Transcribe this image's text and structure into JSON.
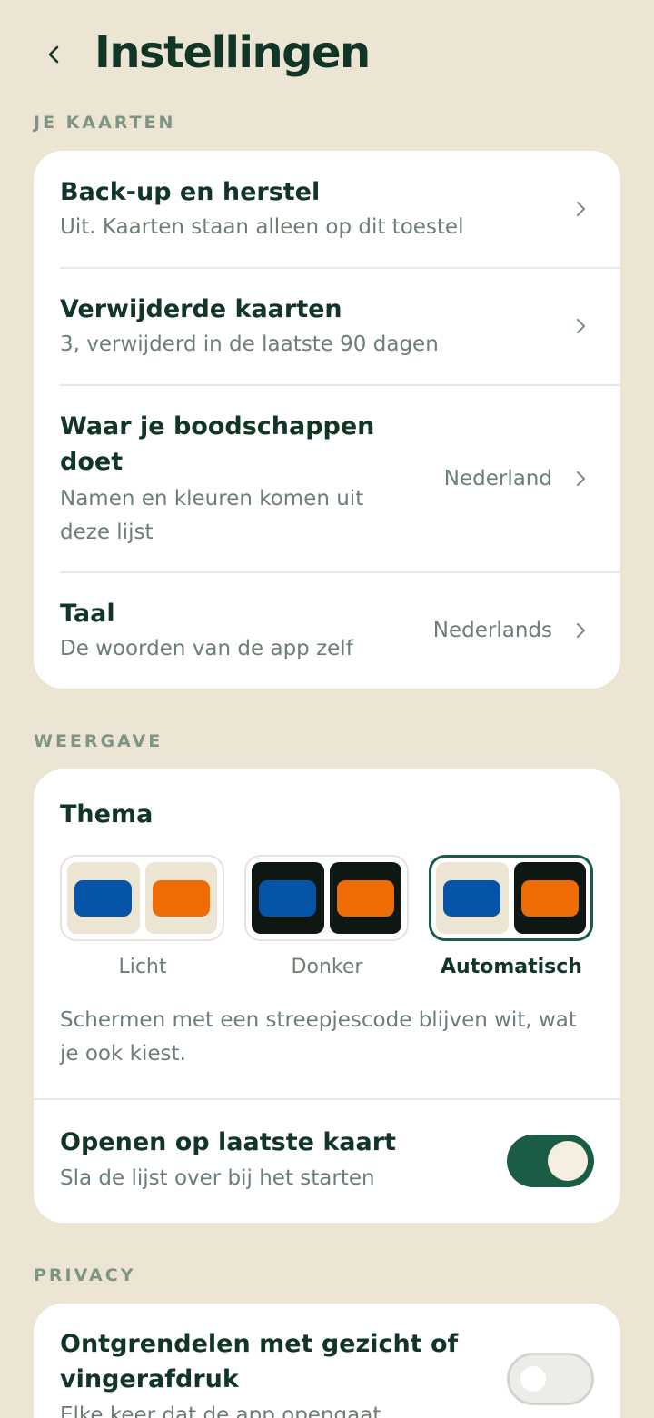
{
  "header": {
    "title": "Instellingen"
  },
  "sections": {
    "cards": {
      "label": "JE KAARTEN",
      "items": [
        {
          "title": "Back-up en herstel",
          "subtitle": "Uit. Kaarten staan alleen op dit toestel",
          "value": ""
        },
        {
          "title": "Verwijderde kaarten",
          "subtitle": "3, verwijderd in de laatste 90 dagen",
          "value": ""
        },
        {
          "title": "Waar je boodschappen doet",
          "subtitle": "Namen en kleuren komen uit deze lijst",
          "value": "Nederland"
        },
        {
          "title": "Taal",
          "subtitle": "De woorden van de app zelf",
          "value": "Nederlands"
        }
      ]
    },
    "display": {
      "label": "WEERGAVE",
      "theme": {
        "title": "Thema",
        "options": [
          {
            "label": "Licht",
            "selected": false
          },
          {
            "label": "Donker",
            "selected": false
          },
          {
            "label": "Automatisch",
            "selected": true
          }
        ],
        "note": "Schermen met een streepjescode blijven wit, wat je ook kiest."
      },
      "open_last": {
        "title": "Openen op laatste kaart",
        "subtitle": "Sla de lijst over bij het starten",
        "enabled": true
      }
    },
    "privacy": {
      "label": "PRIVACY",
      "biometric": {
        "title": "Ontgrendelen met gezicht of vingerafdruk",
        "subtitle": "Elke keer dat de app opengaat",
        "enabled": false
      }
    }
  },
  "colors": {
    "background": "#ECE5D3",
    "card": "#FFFFFF",
    "primary_text": "#123626",
    "secondary_text": "#6B7F72",
    "accent": "#1B5C47",
    "theme_blue": "#0554A8",
    "theme_orange": "#EF6C04"
  }
}
